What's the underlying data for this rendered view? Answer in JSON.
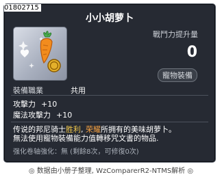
{
  "item": {
    "id": "01802715",
    "name": "小小胡萝卜",
    "stat_label": "戰鬥力提升量",
    "stat_value": "0",
    "tag": "寵物裝備",
    "job_label": "裝備職業",
    "job_value": "共用"
  },
  "attributes": [
    {
      "label": "攻擊力",
      "value": "+10"
    },
    {
      "label": "魔法攻擊力",
      "value": "+10"
    }
  ],
  "description": {
    "line1_pre": "传说的邦尼骑士",
    "line1_hl1": "胜利",
    "line1_sep": ", ",
    "line1_hl2": "荣耀",
    "line1_post": "所拥有的美味胡萝卜。",
    "line2": "無法使用寵物裝備能力值轉移咒文書的物品."
  },
  "upgrade": "强化卷轴強化：無 (剩餘8次，可修復0次)",
  "footer": "◎ 数据由小册子整理, WzComparerR2-NTMS解析 ◎",
  "colors": {
    "background": "#262a33",
    "highlight": "#f2c94c",
    "highlight_alt": "#f5a142"
  },
  "icons": [
    "carrot-pet-equip-icon",
    "heart-icon",
    "gold-coin-icon",
    "sparkle-icon"
  ]
}
